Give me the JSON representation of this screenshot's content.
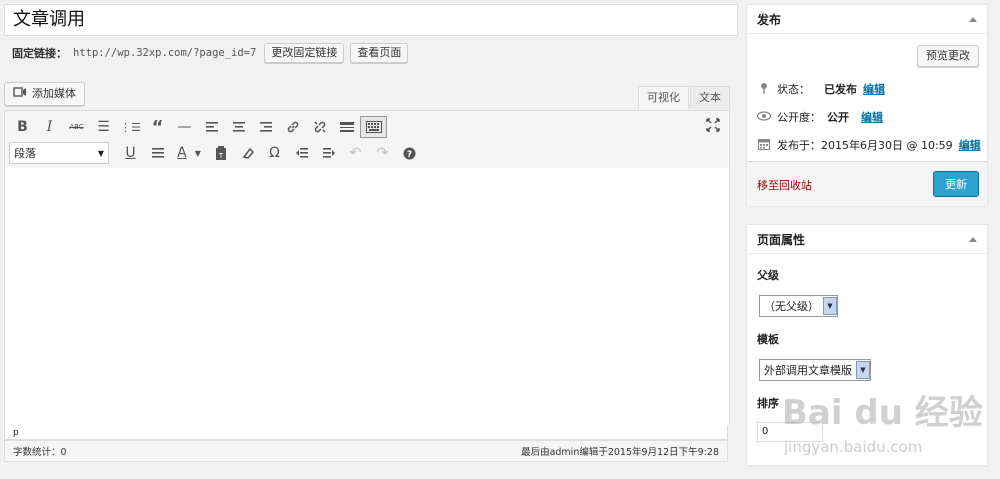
{
  "post": {
    "title": "文章调用",
    "permalink_label": "固定链接：",
    "permalink_url": "http://wp.32xp.com/?page_id=7",
    "change_permalink": "更改固定链接",
    "view_page": "查看页面"
  },
  "editor": {
    "add_media": "添加媒体",
    "tabs": {
      "visual": "可视化",
      "text": "文本"
    },
    "format_select": "段落",
    "path": "p",
    "word_count": "字数统计：0",
    "last_edited": "最后由admin编辑于2015年9月12日下午9:28"
  },
  "publish": {
    "title": "发布",
    "preview": "预览更改",
    "status_label": "状态：",
    "status_value": "已发布",
    "visibility_label": "公开度：",
    "visibility_value": "公开",
    "published_label": "发布于：",
    "published_value": "2015年6月30日 @ 10:59",
    "edit": "编辑",
    "trash": "移至回收站",
    "update": "更新"
  },
  "page_attributes": {
    "title": "页面属性",
    "parent_label": "父级",
    "parent_value": "（无父级）",
    "template_label": "模板",
    "template_value": "外部调用文章模版",
    "order_label": "排序",
    "order_value": "0"
  },
  "watermark": {
    "brand": "Bai du 经验",
    "url": "jingyan.baidu.com"
  },
  "colors": {
    "primary": "#2ea2cc",
    "link": "#0073aa",
    "trash": "#aa0000"
  }
}
